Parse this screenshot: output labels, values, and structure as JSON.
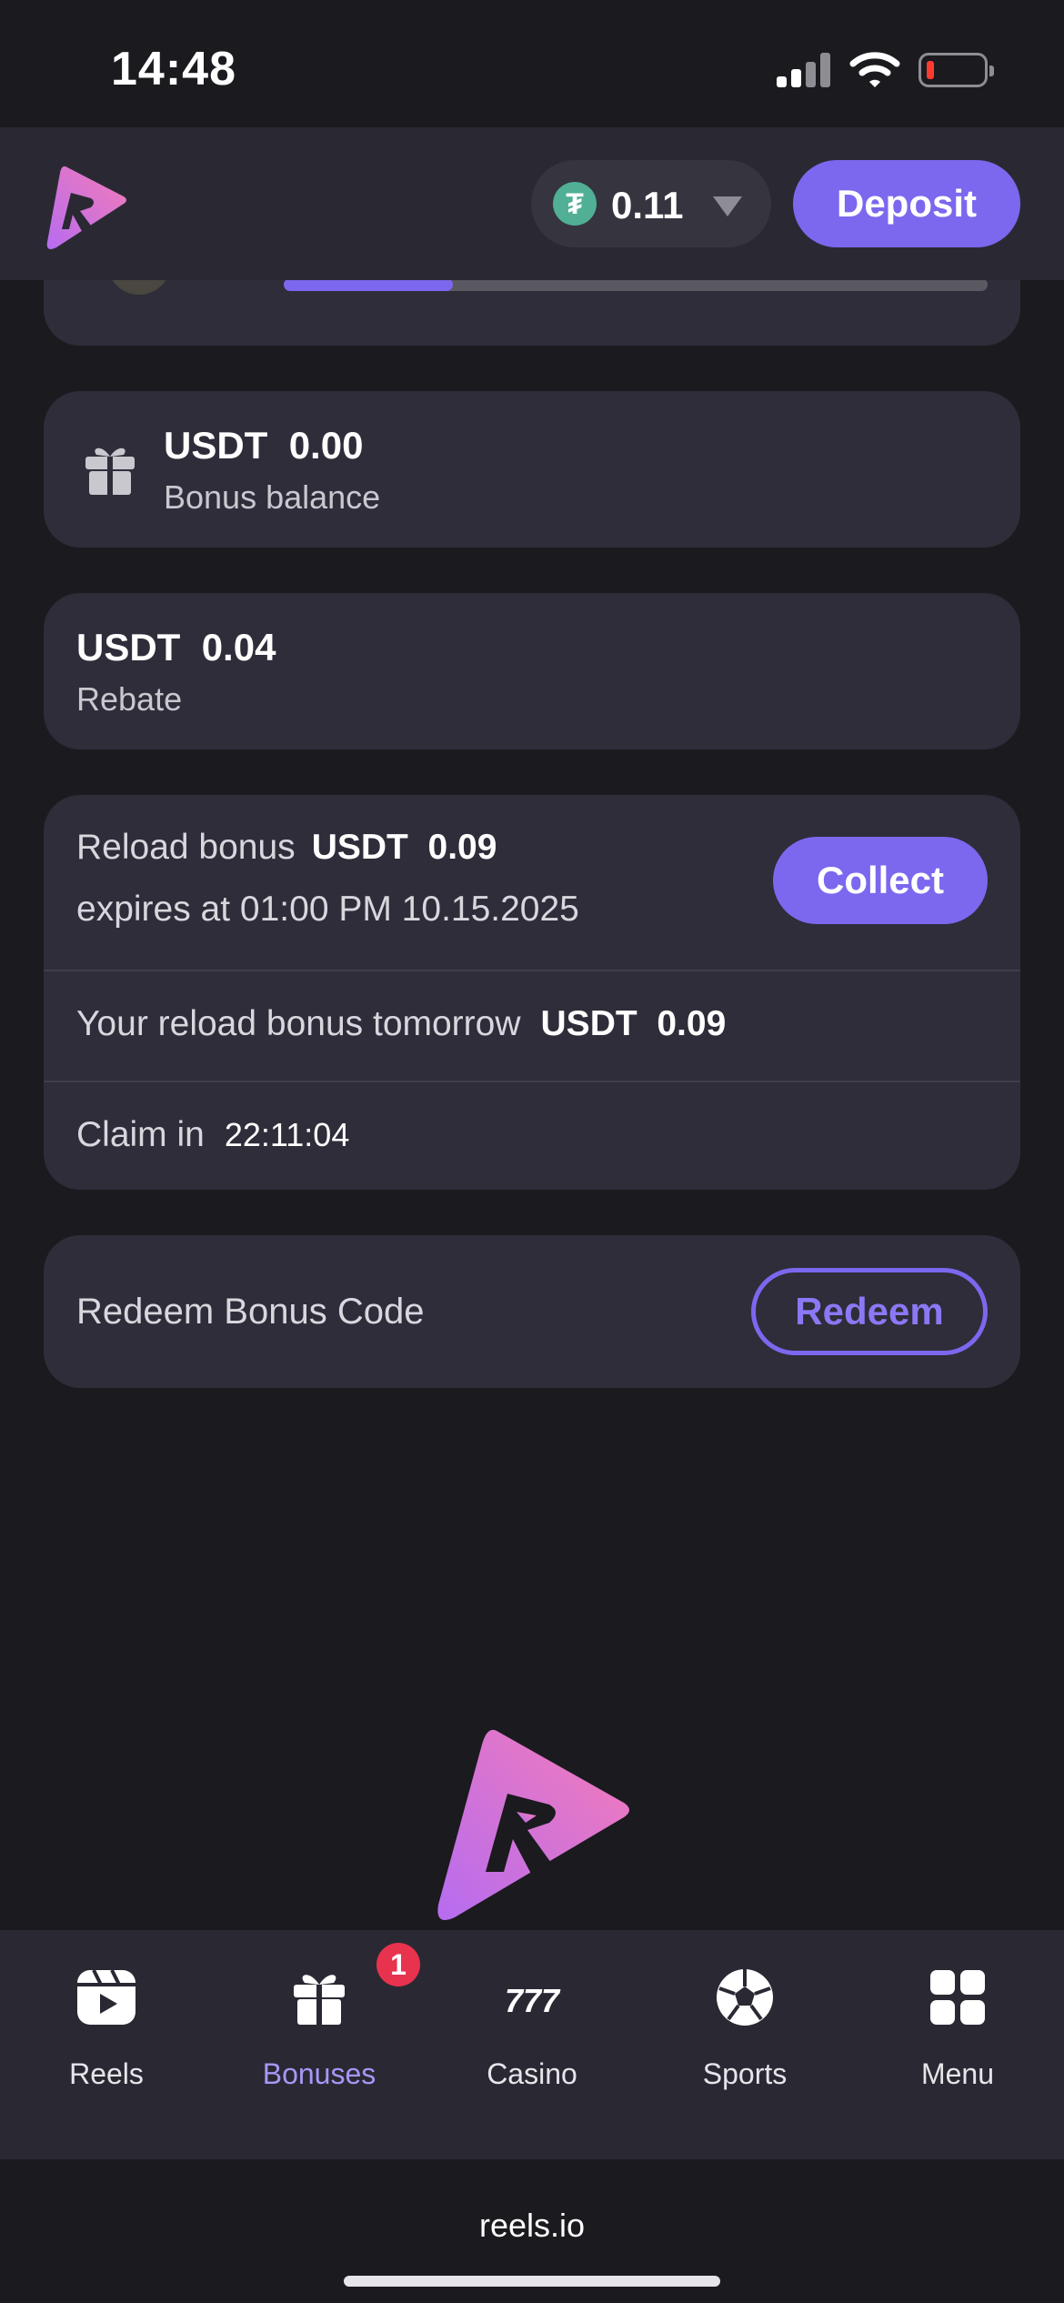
{
  "status_bar": {
    "time": "14:48"
  },
  "header": {
    "balance": "0.11",
    "currency_icon": "tether-icon",
    "deposit_label": "Deposit"
  },
  "progress": {
    "fraction": 0.24
  },
  "bonus_balance": {
    "currency": "USDT",
    "amount": "0.00",
    "label": "Bonus balance"
  },
  "rebate": {
    "currency": "USDT",
    "amount": "0.04",
    "label": "Rebate"
  },
  "reload": {
    "label": "Reload bonus",
    "currency": "USDT",
    "amount": "0.09",
    "expires": "expires at 01:00 PM 10.15.2025",
    "collect_label": "Collect",
    "tomorrow_label": "Your reload bonus tomorrow",
    "tomorrow_currency": "USDT",
    "tomorrow_amount": "0.09",
    "claim_label": "Claim in",
    "claim_timer": "22:11:04"
  },
  "redeem": {
    "label": "Redeem Bonus Code",
    "button_label": "Redeem"
  },
  "bottom_nav": {
    "items": [
      {
        "label": "Reels",
        "icon": "reels-play-icon",
        "active": false
      },
      {
        "label": "Bonuses",
        "icon": "gift-icon",
        "active": true,
        "badge": "1"
      },
      {
        "label": "Casino",
        "icon": "slot-777-icon",
        "active": false
      },
      {
        "label": "Sports",
        "icon": "soccer-ball-icon",
        "active": false
      },
      {
        "label": "Menu",
        "icon": "grid-menu-icon",
        "active": false
      }
    ]
  },
  "browser": {
    "url": "reels.io"
  },
  "colors": {
    "accent": "#7b68ee",
    "background": "#1b1a1f",
    "card": "#2e2d39",
    "badge": "#e8334f"
  }
}
